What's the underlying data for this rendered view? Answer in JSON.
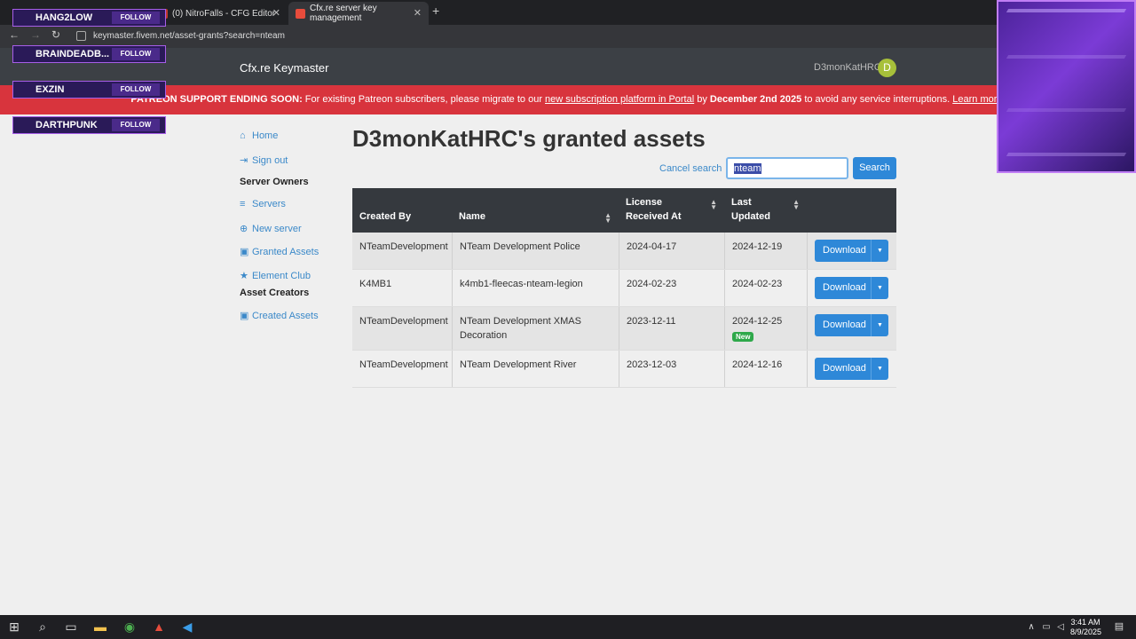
{
  "browser": {
    "tabs": [
      {
        "label": "(0) NitroFalls - CFG Editor",
        "close": "✕"
      },
      {
        "label": "Cfx.re server key management",
        "close": "✕"
      }
    ],
    "new_tab": "+",
    "url": "keymaster.fivem.net/asset-grants?search=nteam"
  },
  "header": {
    "brand": "Cfx.re Keymaster",
    "username": "D3monKatHRC",
    "avatar_letter": "D"
  },
  "banner": {
    "strong_prefix": "PATREON SUPPORT ENDING SOON:",
    "text1": " For existing Patreon subscribers, please migrate to our ",
    "link1": "new subscription platform in Portal",
    "text2": " by ",
    "date": "December 2nd 2025",
    "text3": " to avoid any service interruptions. ",
    "link2": "Learn more."
  },
  "sidebar": {
    "home": "Home",
    "sign_out": "Sign out",
    "server_owners": "Server Owners",
    "servers": "Servers",
    "new_server": "New server",
    "granted_assets": "Granted Assets",
    "element_club": "Element Club",
    "asset_creators": "Asset Creators",
    "created_assets": "Created Assets"
  },
  "page": {
    "title": "D3monKatHRC's granted assets",
    "cancel_search": "Cancel search",
    "search_value": "nteam",
    "search_button": "Search"
  },
  "table": {
    "headers": {
      "created_by": "Created By",
      "name": "Name",
      "license": "License Received At",
      "last_updated": "Last Updated"
    },
    "rows": [
      {
        "created_by": "NTeamDevelopment",
        "name": "NTeam Development Police",
        "license": "2024-04-17",
        "updated": "2024-12-19",
        "badge": "",
        "download": "Download"
      },
      {
        "created_by": "K4MB1",
        "name": "k4mb1-fleecas-nteam-legion",
        "license": "2024-02-23",
        "updated": "2024-02-23",
        "badge": "",
        "download": "Download"
      },
      {
        "created_by": "NTeamDevelopment",
        "name": "NTeam Development XMAS Decoration",
        "license": "2023-12-11",
        "updated": "2024-12-25",
        "badge": "New",
        "download": "Download"
      },
      {
        "created_by": "NTeamDevelopment",
        "name": "NTeam Development River",
        "license": "2023-12-03",
        "updated": "2024-12-16",
        "badge": "",
        "download": "Download"
      }
    ]
  },
  "overlay": {
    "follows": [
      {
        "name": "HANG2LOW",
        "follow": "FOLLOW"
      },
      {
        "name": "BRAINDEADB...",
        "follow": "FOLLOW"
      },
      {
        "name": "EXZIN",
        "follow": "FOLLOW"
      },
      {
        "name": "DARTHPUNK",
        "follow": "FOLLOW"
      }
    ]
  },
  "taskbar": {
    "time": "3:41 AM",
    "date": "8/9/2025"
  },
  "colors": {
    "header_bg": "#3c4045",
    "banner_bg": "#d8343d",
    "primary": "#2e88d8",
    "link": "#3b89c9",
    "table_head": "#35393e",
    "new_badge": "#2ea84a"
  }
}
